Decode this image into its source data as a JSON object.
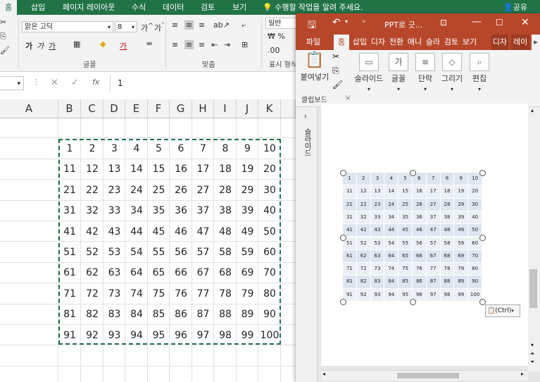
{
  "excel": {
    "tabs": [
      "홈",
      "삽입",
      "페이지 레이아웃",
      "수식",
      "데이터",
      "검토",
      "보기"
    ],
    "tell_me": "수행할 작업을 알려 주세요.",
    "share": "공유",
    "font_name": "맑은 고딕",
    "font_size": "8",
    "number_format": "일반",
    "group_font": "글꼴",
    "group_align": "맞춤",
    "group_number": "표시 형식",
    "formula_value": "1",
    "columns": [
      "A",
      "B",
      "C",
      "D",
      "E",
      "F",
      "G",
      "H",
      "I",
      "J",
      "K"
    ],
    "grid": [
      [
        1,
        2,
        3,
        4,
        5,
        6,
        7,
        8,
        9,
        10
      ],
      [
        11,
        12,
        13,
        14,
        15,
        16,
        17,
        18,
        19,
        20
      ],
      [
        21,
        22,
        23,
        24,
        25,
        26,
        27,
        28,
        29,
        30
      ],
      [
        31,
        32,
        33,
        34,
        35,
        36,
        37,
        38,
        39,
        40
      ],
      [
        41,
        42,
        43,
        44,
        45,
        46,
        47,
        48,
        49,
        50
      ],
      [
        51,
        52,
        53,
        54,
        55,
        56,
        57,
        58,
        59,
        60
      ],
      [
        61,
        62,
        63,
        64,
        65,
        66,
        67,
        68,
        69,
        70
      ],
      [
        71,
        72,
        73,
        74,
        75,
        76,
        77,
        78,
        79,
        80
      ],
      [
        81,
        82,
        83,
        84,
        85,
        86,
        87,
        88,
        89,
        90
      ],
      [
        91,
        92,
        93,
        94,
        95,
        96,
        97,
        98,
        99,
        100
      ]
    ]
  },
  "ppt": {
    "title": "PPT로 긋...",
    "tabs": [
      "파일",
      "홈",
      "삽입",
      "디자",
      "전환",
      "애니",
      "슬라",
      "검토",
      "보기",
      "디자",
      "레이"
    ],
    "groups": [
      "붙여넣기",
      "슬라이드",
      "글꼴",
      "단락",
      "그리기",
      "편집"
    ],
    "clipboard": "클립보드",
    "thumb_label": "슬라이드",
    "paste_ctrl": "(Ctrl)"
  }
}
